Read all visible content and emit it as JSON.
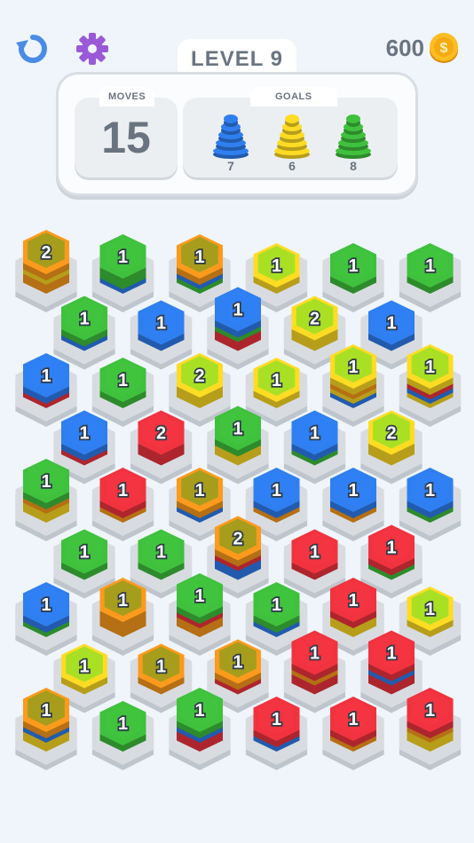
{
  "header": {
    "level_label": "LEVEL 9",
    "coins": "600",
    "restart_icon": "restart-icon",
    "settings_icon": "gear-icon",
    "coin_icon": "coin-icon"
  },
  "panel": {
    "moves_label": "MOVES",
    "moves_value": "15",
    "goals_label": "GOALS",
    "goals": [
      {
        "color": "blue",
        "count": "7"
      },
      {
        "color": "yellow",
        "count": "6"
      },
      {
        "color": "green",
        "count": "8"
      }
    ]
  },
  "colors": {
    "red": "#f0333f",
    "orange": "#fb9a1c",
    "yellow": "#fedc24",
    "green": "#3fc13d",
    "blue": "#2f7ff0",
    "slot": "#d8dce1",
    "text": "#6a7480"
  },
  "board": {
    "rows": [
      [
        {
          "count": "2",
          "layers": [
            "orange",
            "yellow",
            "orange",
            "orange"
          ]
        },
        {
          "count": "1",
          "layers": [
            "green",
            "green",
            "blue"
          ]
        },
        {
          "count": "1",
          "layers": [
            "orange",
            "blue",
            "green"
          ]
        },
        {
          "count": "1",
          "layers": [
            "yellow"
          ]
        },
        {
          "count": "1",
          "layers": [
            "green"
          ]
        },
        {
          "count": "1",
          "layers": [
            "green"
          ]
        }
      ],
      [
        {
          "count": "1",
          "layers": [
            "green",
            "blue"
          ]
        },
        {
          "count": "1",
          "layers": [
            "blue"
          ]
        },
        {
          "count": "1",
          "layers": [
            "blue",
            "green",
            "red",
            "red"
          ]
        },
        {
          "count": "2",
          "layers": [
            "yellow",
            "yellow"
          ]
        },
        {
          "count": "1",
          "layers": [
            "blue"
          ]
        }
      ],
      [
        {
          "count": "1",
          "layers": [
            "blue",
            "red"
          ]
        },
        {
          "count": "1",
          "layers": [
            "green"
          ]
        },
        {
          "count": "2",
          "layers": [
            "yellow",
            "yellow"
          ]
        },
        {
          "count": "1",
          "layers": [
            "yellow"
          ]
        },
        {
          "count": "1",
          "layers": [
            "yellow",
            "orange",
            "yellow",
            "blue"
          ]
        },
        {
          "count": "1",
          "layers": [
            "yellow",
            "red",
            "blue",
            "yellow"
          ]
        }
      ],
      [
        {
          "count": "1",
          "layers": [
            "blue",
            "red"
          ]
        },
        {
          "count": "2",
          "layers": [
            "red",
            "red"
          ]
        },
        {
          "count": "1",
          "layers": [
            "green",
            "yellow",
            "yellow"
          ]
        },
        {
          "count": "1",
          "layers": [
            "blue",
            "green"
          ]
        },
        {
          "count": "2",
          "layers": [
            "yellow",
            "yellow"
          ]
        }
      ],
      [
        {
          "count": "1",
          "layers": [
            "green",
            "orange",
            "yellow",
            "yellow"
          ]
        },
        {
          "count": "1",
          "layers": [
            "red",
            "orange"
          ]
        },
        {
          "count": "1",
          "layers": [
            "orange",
            "blue"
          ]
        },
        {
          "count": "1",
          "layers": [
            "blue",
            "orange"
          ]
        },
        {
          "count": "1",
          "layers": [
            "blue",
            "orange"
          ]
        },
        {
          "count": "1",
          "layers": [
            "blue",
            "green"
          ]
        }
      ],
      [
        {
          "count": "1",
          "layers": [
            "green"
          ]
        },
        {
          "count": "1",
          "layers": [
            "green"
          ]
        },
        {
          "count": "2",
          "layers": [
            "orange",
            "red",
            "blue",
            "blue"
          ]
        },
        {
          "count": "1",
          "layers": [
            "red"
          ]
        },
        {
          "count": "1",
          "layers": [
            "red",
            "green"
          ]
        }
      ],
      [
        {
          "count": "1",
          "layers": [
            "blue",
            "green"
          ]
        },
        {
          "count": "1",
          "layers": [
            "orange",
            "orange",
            "orange"
          ]
        },
        {
          "count": "1",
          "layers": [
            "green",
            "red",
            "orange",
            "orange"
          ]
        },
        {
          "count": "1",
          "layers": [
            "green",
            "blue"
          ]
        },
        {
          "count": "1",
          "layers": [
            "red",
            "yellow",
            "yellow"
          ]
        },
        {
          "count": "1",
          "layers": [
            "yellow"
          ]
        }
      ],
      [
        {
          "count": "1",
          "layers": [
            "yellow"
          ]
        },
        {
          "count": "1",
          "layers": [
            "orange"
          ]
        },
        {
          "count": "1",
          "layers": [
            "orange",
            "red"
          ]
        },
        {
          "count": "1",
          "layers": [
            "red",
            "orange",
            "red",
            "red"
          ]
        },
        {
          "count": "1",
          "layers": [
            "red",
            "blue",
            "red",
            "red"
          ]
        }
      ],
      [
        {
          "count": "1",
          "layers": [
            "orange",
            "blue",
            "yellow",
            "yellow"
          ]
        },
        {
          "count": "1",
          "layers": [
            "green"
          ]
        },
        {
          "count": "1",
          "layers": [
            "green",
            "blue",
            "red",
            "red"
          ]
        },
        {
          "count": "1",
          "layers": [
            "red",
            "blue"
          ]
        },
        {
          "count": "1",
          "layers": [
            "red",
            "orange"
          ]
        },
        {
          "count": "1",
          "layers": [
            "red",
            "orange",
            "yellow",
            "yellow"
          ]
        }
      ]
    ]
  }
}
